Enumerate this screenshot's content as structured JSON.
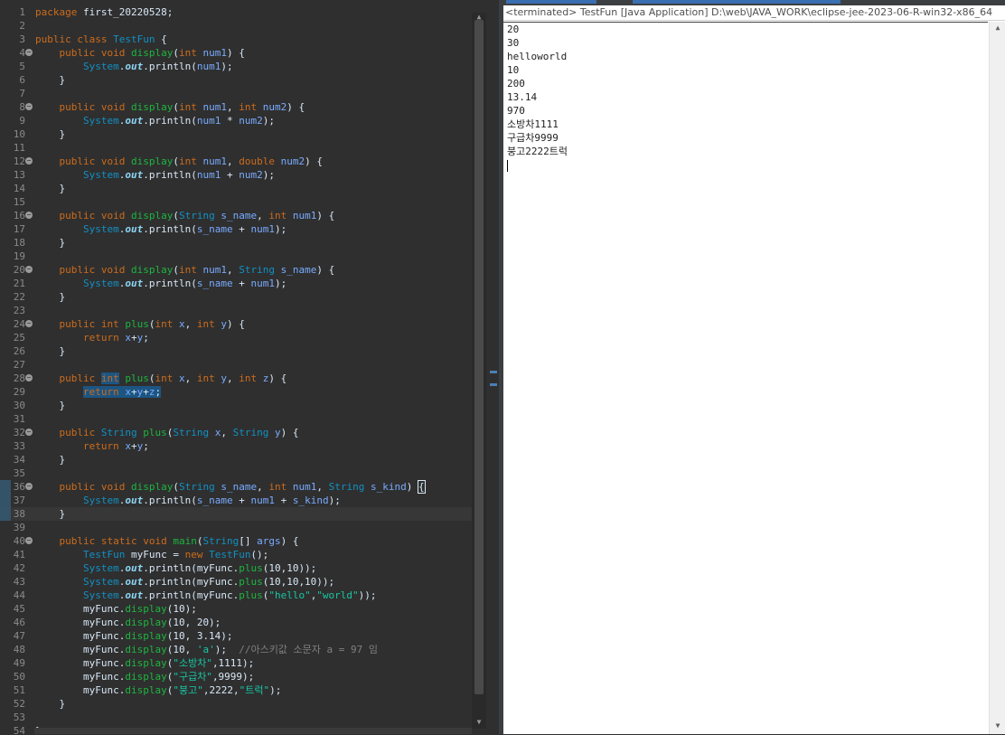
{
  "editor": {
    "lines": [
      {
        "n": "1",
        "text": "package first_20220528;"
      },
      {
        "n": "2",
        "text": ""
      },
      {
        "n": "3",
        "text": "public class TestFun {"
      },
      {
        "n": "4",
        "text": "    public void display(int num1) {",
        "fold": true
      },
      {
        "n": "5",
        "text": "        System.out.println(num1);"
      },
      {
        "n": "6",
        "text": "    }"
      },
      {
        "n": "7",
        "text": ""
      },
      {
        "n": "8",
        "text": "    public void display(int num1, int num2) {",
        "fold": true
      },
      {
        "n": "9",
        "text": "        System.out.println(num1 * num2);"
      },
      {
        "n": "10",
        "text": "    }"
      },
      {
        "n": "11",
        "text": ""
      },
      {
        "n": "12",
        "text": "    public void display(int num1, double num2) {",
        "fold": true
      },
      {
        "n": "13",
        "text": "        System.out.println(num1 + num2);"
      },
      {
        "n": "14",
        "text": "    }"
      },
      {
        "n": "15",
        "text": ""
      },
      {
        "n": "16",
        "text": "    public void display(String s_name, int num1) {",
        "fold": true
      },
      {
        "n": "17",
        "text": "        System.out.println(s_name + num1);"
      },
      {
        "n": "18",
        "text": "    }"
      },
      {
        "n": "19",
        "text": ""
      },
      {
        "n": "20",
        "text": "    public void display(int num1, String s_name) {",
        "fold": true
      },
      {
        "n": "21",
        "text": "        System.out.println(s_name + num1);"
      },
      {
        "n": "22",
        "text": "    }"
      },
      {
        "n": "23",
        "text": ""
      },
      {
        "n": "24",
        "text": "    public int plus(int x, int y) {",
        "fold": true
      },
      {
        "n": "25",
        "text": "        return x+y;"
      },
      {
        "n": "26",
        "text": "    }"
      },
      {
        "n": "27",
        "text": ""
      },
      {
        "n": "28",
        "text": "    public int plus(int x, int y, int z) {",
        "fold": true
      },
      {
        "n": "29",
        "text": "        return x+y+z;"
      },
      {
        "n": "30",
        "text": "    }"
      },
      {
        "n": "31",
        "text": ""
      },
      {
        "n": "32",
        "text": "    public String plus(String x, String y) {",
        "fold": true
      },
      {
        "n": "33",
        "text": "        return x+y;"
      },
      {
        "n": "34",
        "text": "    }"
      },
      {
        "n": "35",
        "text": ""
      },
      {
        "n": "36",
        "text": "    public void display(String s_name, int num1, String s_kind) {",
        "fold": true
      },
      {
        "n": "37",
        "text": "        System.out.println(s_name + num1 + s_kind);"
      },
      {
        "n": "38",
        "text": "    }"
      },
      {
        "n": "39",
        "text": ""
      },
      {
        "n": "40",
        "text": "    public static void main(String[] args) {",
        "fold": true
      },
      {
        "n": "41",
        "text": "        TestFun myFunc = new TestFun();"
      },
      {
        "n": "42",
        "text": "        System.out.println(myFunc.plus(10,10));"
      },
      {
        "n": "43",
        "text": "        System.out.println(myFunc.plus(10,10,10));"
      },
      {
        "n": "44",
        "text": "        System.out.println(myFunc.plus(\"hello\",\"world\"));"
      },
      {
        "n": "45",
        "text": "        myFunc.display(10);"
      },
      {
        "n": "46",
        "text": "        myFunc.display(10, 20);"
      },
      {
        "n": "47",
        "text": "        myFunc.display(10, 3.14);"
      },
      {
        "n": "48",
        "text": "        myFunc.display(10, 'a');  //아스키값 소문자 a = 97 임"
      },
      {
        "n": "49",
        "text": "        myFunc.display(\"소방차\",1111);"
      },
      {
        "n": "50",
        "text": "        myFunc.display(\"구급차\",9999);"
      },
      {
        "n": "51",
        "text": "        myFunc.display(\"붕고\",2222,\"트럭\");"
      },
      {
        "n": "52",
        "text": "    }"
      },
      {
        "n": "53",
        "text": ""
      },
      {
        "n": "54",
        "text": "}"
      }
    ]
  },
  "console": {
    "header": "<terminated> TestFun [Java Application] D:\\web\\JAVA_WORK\\eclipse-jee-2023-06-R-win32-x86_64",
    "output": [
      "20",
      "30",
      "helloworld",
      "10",
      "200",
      "13.14",
      "970",
      "소방차1111",
      "구급차9999",
      "붕고2222트럭"
    ]
  },
  "icons": {
    "fold": "collapse-fold-icon",
    "scroll_up": "scroll-up-arrow-icon",
    "scroll_down": "scroll-down-arrow-icon"
  },
  "colors": {
    "keyword": "#cc6c1d",
    "type": "#1290c3",
    "method": "#1eb540",
    "param": "#79abff",
    "string": "#17c6a3",
    "selection": "#1d5582"
  }
}
